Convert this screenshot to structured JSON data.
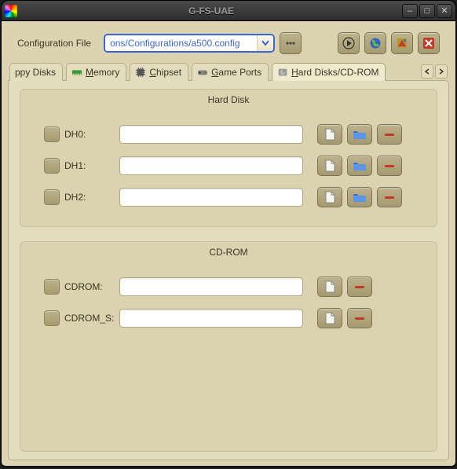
{
  "window": {
    "title": "G-FS-UAE"
  },
  "topbar": {
    "label": "Configuration File",
    "config_value": "ons/Configurations/a500.config"
  },
  "tabs": {
    "items": [
      {
        "label": "ppy Disks"
      },
      {
        "label_pre": "",
        "underline": "M",
        "label_post": "emory"
      },
      {
        "label_pre": "",
        "underline": "C",
        "label_post": "hipset"
      },
      {
        "label_pre": "",
        "underline": "G",
        "label_post": "ame Ports"
      },
      {
        "label_pre": "",
        "underline": "H",
        "label_post": "ard Disks/CD-ROM"
      }
    ]
  },
  "harddisk": {
    "caption": "Hard Disk",
    "rows": [
      {
        "label": "DH0:",
        "value": ""
      },
      {
        "label": "DH1:",
        "value": ""
      },
      {
        "label": "DH2:",
        "value": ""
      }
    ]
  },
  "cdrom": {
    "caption": "CD-ROM",
    "rows": [
      {
        "label": "CDROM:",
        "value": ""
      },
      {
        "label": "CDROM_S:",
        "value": ""
      }
    ]
  }
}
